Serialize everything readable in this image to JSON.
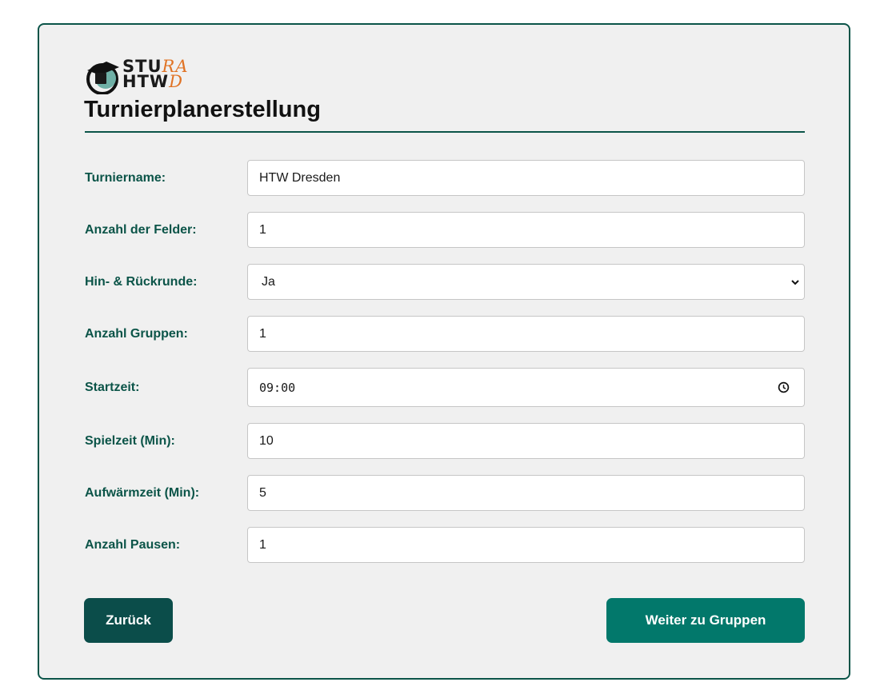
{
  "logo": {
    "line1_dark": "STU",
    "line1_accent": "RA",
    "line2_dark": "HTW",
    "line2_accent": "D"
  },
  "page": {
    "title": "Turnierplanerstellung"
  },
  "form": {
    "tournament_name": {
      "label": "Turniername:",
      "value": "HTW Dresden"
    },
    "field_count": {
      "label": "Anzahl der Felder:",
      "value": "1"
    },
    "return_round": {
      "label": "Hin- & Rückrunde:",
      "value": "Ja"
    },
    "group_count": {
      "label": "Anzahl Gruppen:",
      "value": "1"
    },
    "start_time": {
      "label": "Startzeit:",
      "value": "09:00"
    },
    "play_time": {
      "label": "Spielzeit (Min):",
      "value": "10"
    },
    "warmup_time": {
      "label": "Aufwärmzeit (Min):",
      "value": "5"
    },
    "break_count": {
      "label": "Anzahl Pausen:",
      "value": "1"
    }
  },
  "actions": {
    "back_label": "Zurück",
    "next_label": "Weiter zu Gruppen"
  },
  "colors": {
    "primary_dark": "#0b4d4a",
    "primary": "#02786b",
    "accent_orange": "#e07325",
    "label_green": "#0b5448",
    "panel_bg": "#f0f0f0"
  },
  "icons": {
    "select": "chevron-down-icon",
    "time": "clock-icon",
    "logo": "graduation-cap-icon"
  }
}
